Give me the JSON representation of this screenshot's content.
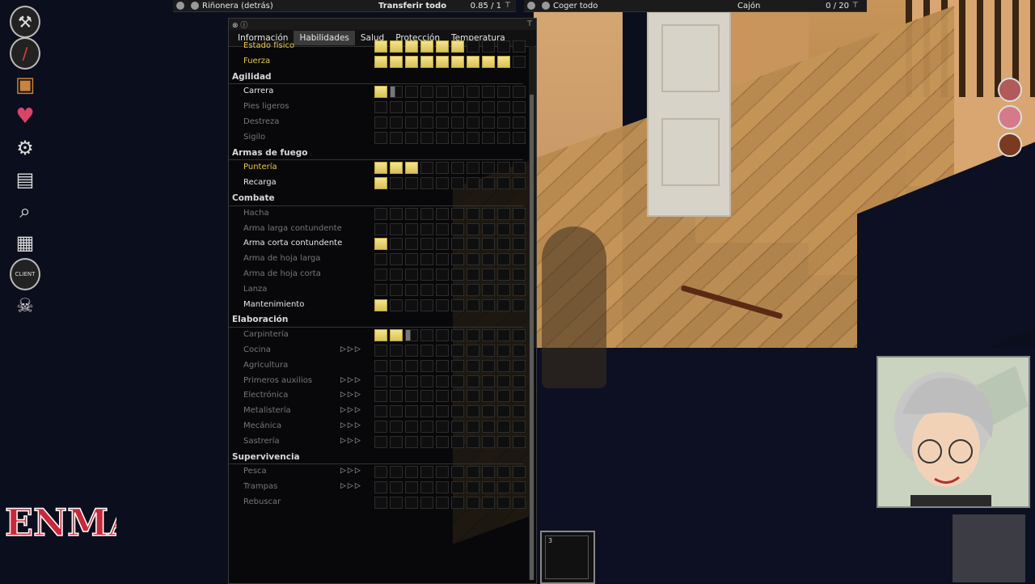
{
  "topbar_left": {
    "title": "Riñonera (detrás)",
    "action": "Transferir todo",
    "weight": "0.85 / 1"
  },
  "topbar_right": {
    "action": "Coger todo",
    "container": "Cajón",
    "weight": "0 / 20"
  },
  "panel": {
    "tabs": [
      "Información",
      "Habilidades",
      "Salud",
      "Protección",
      "Temperatura"
    ],
    "active_tab": "Habilidades"
  },
  "skills": [
    {
      "type": "skill",
      "name": "Estado físico",
      "style": "hl",
      "level": 6,
      "arrows": 0
    },
    {
      "type": "skill",
      "name": "Fuerza",
      "style": "hl",
      "level": 9,
      "arrows": 0
    },
    {
      "type": "category",
      "name": "Agilidad"
    },
    {
      "type": "skill",
      "name": "Carrera",
      "style": "on",
      "level": 1,
      "partial": "grey",
      "arrows": 0
    },
    {
      "type": "skill",
      "name": "Pies ligeros",
      "style": "dim",
      "level": 0,
      "arrows": 0
    },
    {
      "type": "skill",
      "name": "Destreza",
      "style": "dim",
      "level": 0,
      "arrows": 0
    },
    {
      "type": "skill",
      "name": "Sigilo",
      "style": "dim",
      "level": 0,
      "arrows": 0
    },
    {
      "type": "category",
      "name": "Armas de fuego"
    },
    {
      "type": "skill",
      "name": "Puntería",
      "style": "hl",
      "level": 3,
      "arrows": 0
    },
    {
      "type": "skill",
      "name": "Recarga",
      "style": "on",
      "level": 1,
      "arrows": 0
    },
    {
      "type": "category",
      "name": "Combate"
    },
    {
      "type": "skill",
      "name": "Hacha",
      "style": "dim",
      "level": 0,
      "arrows": 0
    },
    {
      "type": "skill",
      "name": "Arma larga contundente",
      "style": "dim",
      "level": 0,
      "arrows": 0
    },
    {
      "type": "skill",
      "name": "Arma corta contundente",
      "style": "on",
      "level": 1,
      "arrows": 0
    },
    {
      "type": "skill",
      "name": "Arma de hoja larga",
      "style": "dim",
      "level": 0,
      "arrows": 0
    },
    {
      "type": "skill",
      "name": "Arma de hoja corta",
      "style": "dim",
      "level": 0,
      "arrows": 0
    },
    {
      "type": "skill",
      "name": "Lanza",
      "style": "dim",
      "level": 0,
      "arrows": 0
    },
    {
      "type": "skill",
      "name": "Mantenimiento",
      "style": "on",
      "level": 1,
      "arrows": 0
    },
    {
      "type": "category",
      "name": "Elaboración"
    },
    {
      "type": "skill",
      "name": "Carpintería",
      "style": "dim",
      "level": 2,
      "partial": "grey",
      "arrows": 0
    },
    {
      "type": "skill",
      "name": "Cocina",
      "style": "dim",
      "level": 0,
      "arrows": 3
    },
    {
      "type": "skill",
      "name": "Agricultura",
      "style": "dim",
      "level": 0,
      "arrows": 0
    },
    {
      "type": "skill",
      "name": "Primeros auxilios",
      "style": "dim",
      "level": 0,
      "arrows": 3
    },
    {
      "type": "skill",
      "name": "Electrónica",
      "style": "dim",
      "level": 0,
      "arrows": 3
    },
    {
      "type": "skill",
      "name": "Metalistería",
      "style": "dim",
      "level": 0,
      "arrows": 3
    },
    {
      "type": "skill",
      "name": "Mecánica",
      "style": "dim",
      "level": 0,
      "arrows": 3
    },
    {
      "type": "skill",
      "name": "Sastrería",
      "style": "dim",
      "level": 0,
      "arrows": 3
    },
    {
      "type": "category",
      "name": "Supervivencia"
    },
    {
      "type": "skill",
      "name": "Pesca",
      "style": "dim",
      "level": 0,
      "arrows": 3
    },
    {
      "type": "skill",
      "name": "Trampas",
      "style": "dim",
      "level": 0,
      "arrows": 3
    },
    {
      "type": "skill",
      "name": "Rebuscar",
      "style": "dim",
      "level": 0,
      "arrows": 0
    }
  ],
  "left_icons": [
    "hammer-icon",
    "knife-icon",
    "box-icon",
    "heart-icon",
    "tools-icon",
    "stove-icon",
    "magnifier-icon",
    "map-icon",
    "client-icon",
    "zombie-icon"
  ],
  "hotbar": {
    "slot_number": "3"
  },
  "logo_text": "ENMA"
}
